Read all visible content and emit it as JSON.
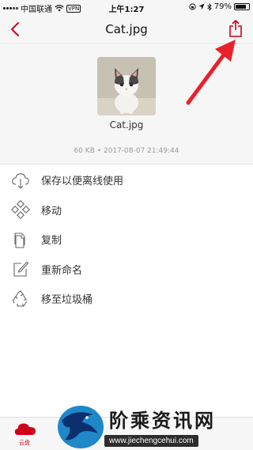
{
  "status_bar": {
    "carrier": "中国联通",
    "vpn": "VPN",
    "time": "上午1:27",
    "battery": "79%",
    "battery_level": 0.79
  },
  "nav": {
    "title": "Cat.jpg",
    "back_icon": "chevron-left-icon",
    "share_icon": "share-icon"
  },
  "file": {
    "name": "Cat.jpg",
    "meta": "60 KB • 2017-08-07 21:49:44"
  },
  "actions": [
    {
      "label": "保存以便离线使用",
      "icon": "cloud-download-icon"
    },
    {
      "label": "移动",
      "icon": "move-icon"
    },
    {
      "label": "复制",
      "icon": "copy-icon"
    },
    {
      "label": "重新命名",
      "icon": "rename-icon"
    },
    {
      "label": "移至垃圾桶",
      "icon": "trash-recycle-icon"
    }
  ],
  "tabbar": {
    "cloud_label": "云盘"
  },
  "watermark": {
    "title": "阶乘资讯网",
    "url": "www.jiechengcehui.com"
  },
  "colors": {
    "accent": "#d0021b",
    "arrow": "#e8212b",
    "background": "#f6f6f6"
  }
}
